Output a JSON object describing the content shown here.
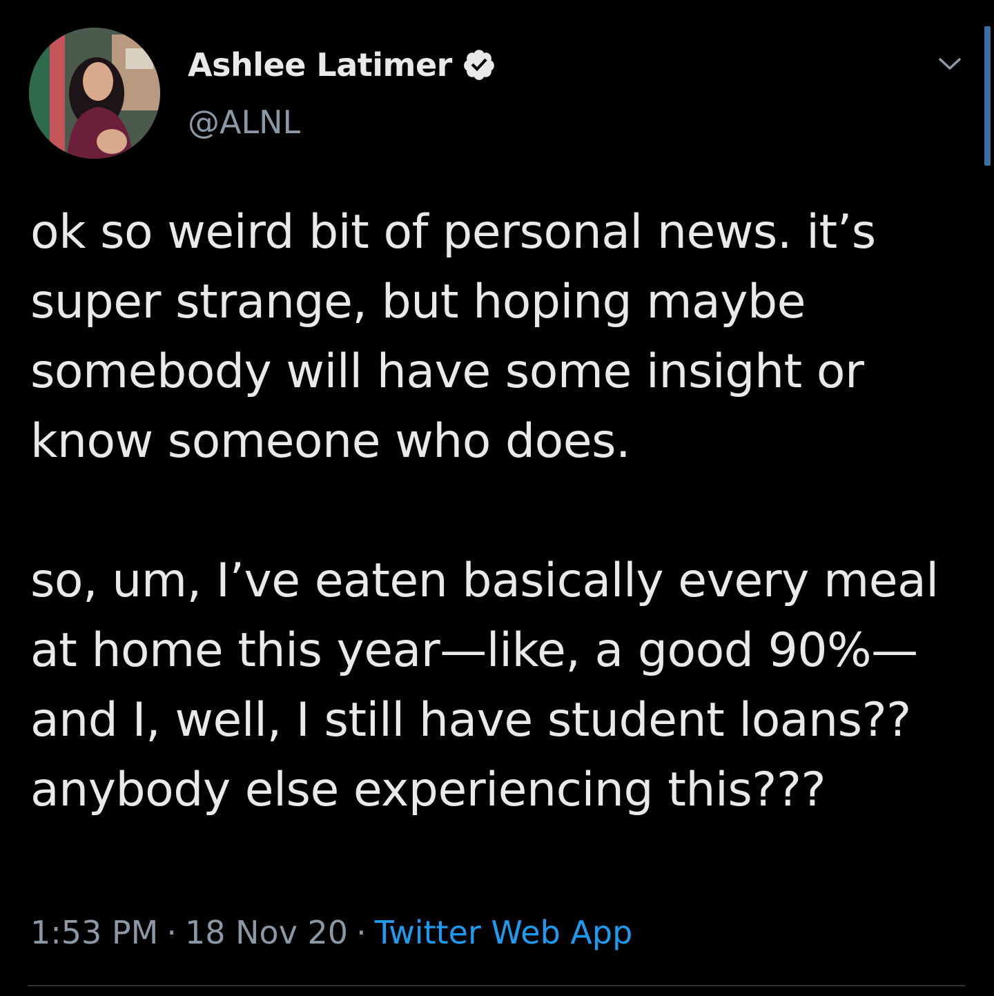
{
  "author": {
    "name": "Ashlee Latimer",
    "handle": "@ALNL",
    "verified": true,
    "verified_icon": "verified-badge-icon"
  },
  "tweet": {
    "text": "ok so weird bit of personal news. it’s super strange, but hoping maybe somebody will have some insight or know someone who does.\n\nso, um, I’ve eaten basically every meal at home this year—like, a good 90%—and I, well, I still have student loans?? anybody else experiencing this???"
  },
  "meta": {
    "time": "1:53 PM",
    "separator": "·",
    "date": "18 Nov 20",
    "source": "Twitter Web App"
  },
  "colors": {
    "background": "#000000",
    "text": "#e7e9ea",
    "secondary": "#8b98a5",
    "link": "#1d9bf0"
  }
}
